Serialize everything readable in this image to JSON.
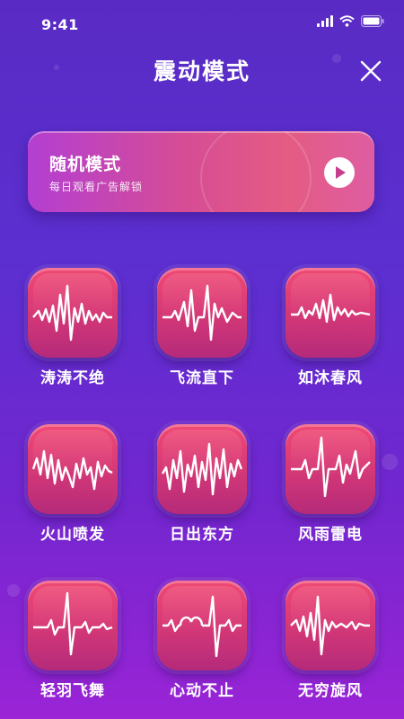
{
  "status_bar": {
    "time": "9:41"
  },
  "header": {
    "title": "震动模式",
    "close_icon": "close-icon"
  },
  "banner": {
    "title": "随机模式",
    "subtitle": "每日观看广告解锁",
    "play_icon": "play-icon"
  },
  "modes": [
    {
      "label": "涛涛不绝"
    },
    {
      "label": "飞流直下"
    },
    {
      "label": "如沐春风"
    },
    {
      "label": "火山喷发"
    },
    {
      "label": "日出东方"
    },
    {
      "label": "风雨雷电"
    },
    {
      "label": "轻羽飞舞"
    },
    {
      "label": "心动不止"
    },
    {
      "label": "无穷旋风"
    }
  ],
  "colors": {
    "accent": "#e4457a",
    "background": "#5b2fd0"
  }
}
